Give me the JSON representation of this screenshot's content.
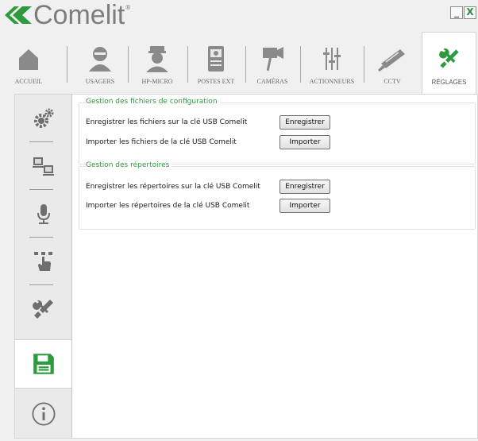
{
  "app": {
    "brand": "Comelit"
  },
  "window_controls": {
    "minimize": "_",
    "close": "X"
  },
  "topnav": {
    "tabs": [
      {
        "label": "ACCUEIL",
        "icon": "home-icon"
      },
      {
        "label": "USAGERS",
        "icon": "user-icon"
      },
      {
        "label": "HP-MICRO",
        "icon": "guard-icon"
      },
      {
        "label": "POSTES EXT",
        "icon": "door-station-icon"
      },
      {
        "label": "CAMÉRAS",
        "icon": "camera-icon"
      },
      {
        "label": "ACTIONNEURS",
        "icon": "sliders-icon"
      },
      {
        "label": "CCTV",
        "icon": "cctv-camera-icon"
      },
      {
        "label": "RÉGLAGES",
        "icon": "tools-icon",
        "active": true
      }
    ]
  },
  "sidenav": {
    "items": [
      {
        "icon": "gears-icon"
      },
      {
        "icon": "network-computers-icon"
      },
      {
        "icon": "microphone-icon"
      },
      {
        "icon": "hand-keypad-icon"
      },
      {
        "icon": "tools-icon"
      },
      {
        "icon": "save-floppy-icon",
        "active": true
      },
      {
        "icon": "info-icon"
      }
    ]
  },
  "main": {
    "config_group": {
      "title": "Gestion des fichiers de configuration",
      "save_label": "Enregistrer les fichiers sur la clé USB Comelit",
      "save_button": "Enregistrer",
      "import_label": "Importer les fichiers de la clé USB Comelit",
      "import_button": "Importer"
    },
    "directory_group": {
      "title": "Gestion des répertoires",
      "save_label": "Enregistrer les répertoires sur la clé USB Comelit",
      "save_button": "Enregistrer",
      "import_label": "Importer les répertoires de la clé USB Comelit",
      "import_button": "Importer"
    }
  },
  "colors": {
    "accent_green": "#2d9a3e",
    "icon_gray": "#8a8a8a"
  }
}
